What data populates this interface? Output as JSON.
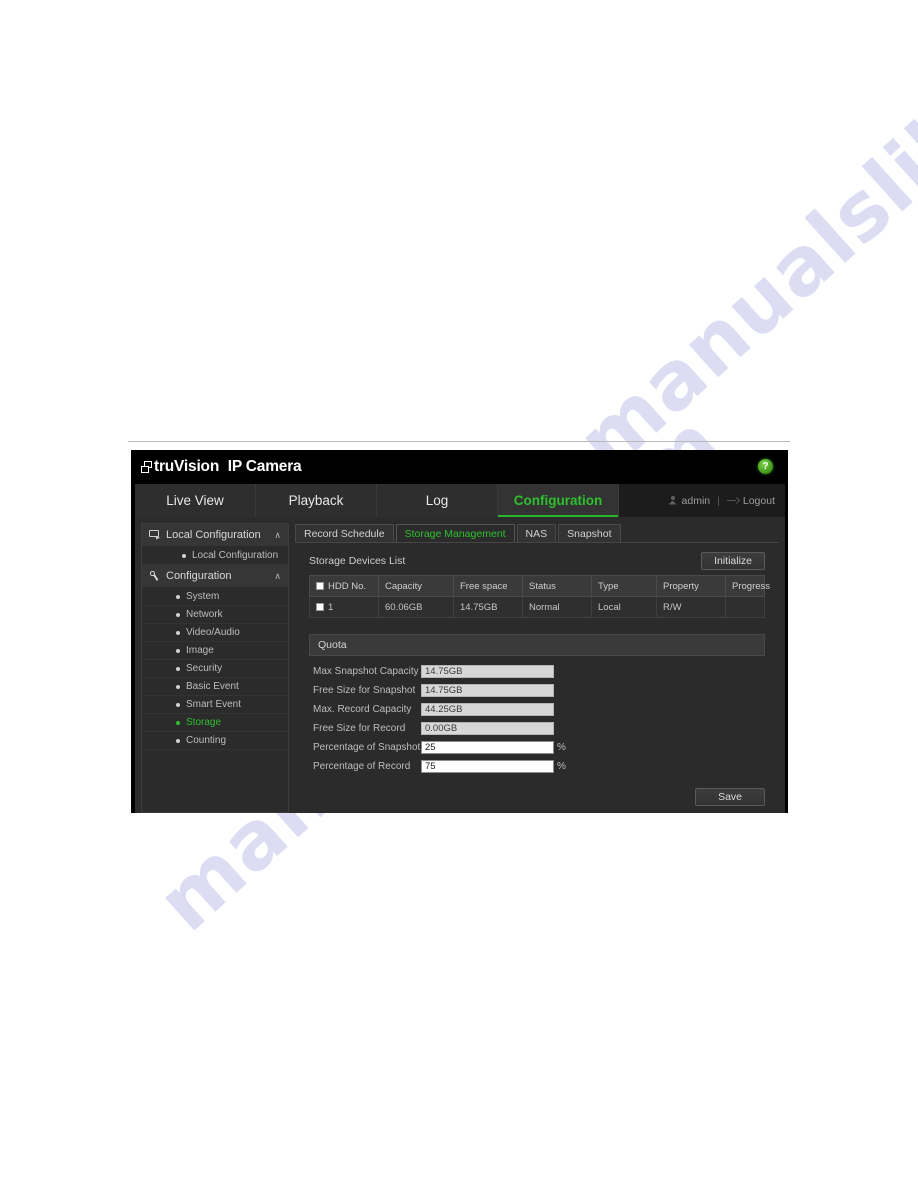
{
  "watermark": {
    "line1": "manualslib.com",
    "line2": "manualslib.com"
  },
  "app": {
    "logo_text_1": "truVision",
    "logo_text_2": "IP Camera",
    "help_label": "?",
    "main_nav": [
      {
        "label": "Live View",
        "active": false
      },
      {
        "label": "Playback",
        "active": false
      },
      {
        "label": "Log",
        "active": false
      },
      {
        "label": "Configuration",
        "active": true
      }
    ],
    "user": {
      "name": "admin",
      "separator": "|",
      "logout": "Logout"
    }
  },
  "sidebar": {
    "groups": [
      {
        "label": "Local Configuration",
        "icon": "monitor-icon",
        "chevron": "∧",
        "items": [
          {
            "label": "Local Configuration",
            "active": false
          }
        ]
      },
      {
        "label": "Configuration",
        "icon": "wrench-icon",
        "chevron": "∧",
        "items": [
          {
            "label": "System",
            "active": false
          },
          {
            "label": "Network",
            "active": false
          },
          {
            "label": "Video/Audio",
            "active": false
          },
          {
            "label": "Image",
            "active": false
          },
          {
            "label": "Security",
            "active": false
          },
          {
            "label": "Basic Event",
            "active": false
          },
          {
            "label": "Smart Event",
            "active": false
          },
          {
            "label": "Storage",
            "active": true
          },
          {
            "label": "Counting",
            "active": false
          }
        ]
      }
    ]
  },
  "content": {
    "subtabs": [
      {
        "label": "Record Schedule",
        "active": false
      },
      {
        "label": "Storage Management",
        "active": true
      },
      {
        "label": "NAS",
        "active": false
      },
      {
        "label": "Snapshot",
        "active": false
      }
    ],
    "storage_list": {
      "title": "Storage Devices List",
      "initialize_label": "Initialize",
      "columns": [
        "HDD No.",
        "Capacity",
        "Free space",
        "Status",
        "Type",
        "Property",
        "Progress"
      ],
      "rows": [
        {
          "hdd_no": "1",
          "capacity": "60.06GB",
          "free_space": "14.75GB",
          "status": "Normal",
          "type": "Local",
          "property": "R/W",
          "progress": ""
        }
      ]
    },
    "quota": {
      "title": "Quota",
      "fields": [
        {
          "label": "Max Snapshot Capacity",
          "value": "14.75GB",
          "unit": "",
          "editable": false
        },
        {
          "label": "Free Size for Snapshot",
          "value": "14.75GB",
          "unit": "",
          "editable": false
        },
        {
          "label": "Max. Record Capacity",
          "value": "44.25GB",
          "unit": "",
          "editable": false
        },
        {
          "label": "Free Size for Record",
          "value": "0.00GB",
          "unit": "",
          "editable": false
        },
        {
          "label": "Percentage of Snapshot",
          "value": "25",
          "unit": "%",
          "editable": true
        },
        {
          "label": "Percentage of Record",
          "value": "75",
          "unit": "%",
          "editable": true
        }
      ]
    },
    "save_label": "Save"
  },
  "colors": {
    "accent_green": "#2fbf2f",
    "window_bg": "#2b2b2b",
    "header_bg": "#000000"
  }
}
